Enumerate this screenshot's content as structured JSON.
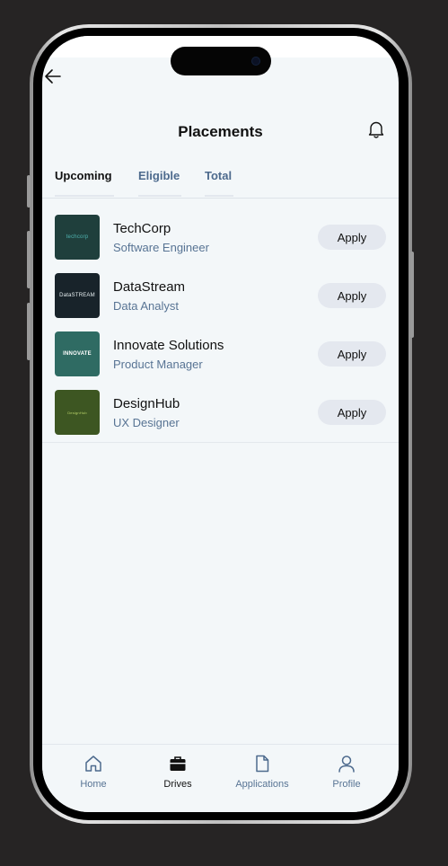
{
  "header": {
    "title": "Placements"
  },
  "tabs": [
    {
      "label": "Upcoming",
      "active": true
    },
    {
      "label": "Eligible",
      "active": false
    },
    {
      "label": "Total",
      "active": false
    }
  ],
  "placements": [
    {
      "company": "TechCorp",
      "role": "Software Engineer",
      "apply_label": "Apply",
      "logo_text": "techcorp",
      "logo_bg": "#1f3f3c"
    },
    {
      "company": "DataStream",
      "role": "Data Analyst",
      "apply_label": "Apply",
      "logo_text": "DataSTREAM",
      "logo_bg": "#18232a"
    },
    {
      "company": "Innovate Solutions",
      "role": "Product Manager",
      "apply_label": "Apply",
      "logo_text": "INNOVATE",
      "logo_bg": "#2f6b63"
    },
    {
      "company": "DesignHub",
      "role": "UX Designer",
      "apply_label": "Apply",
      "logo_text": "DesignHub",
      "logo_bg": "#3d5622"
    }
  ],
  "bottom_nav": [
    {
      "label": "Home",
      "icon": "home-icon",
      "active": false
    },
    {
      "label": "Drives",
      "icon": "briefcase-icon",
      "active": true
    },
    {
      "label": "Applications",
      "icon": "document-icon",
      "active": false
    },
    {
      "label": "Profile",
      "icon": "user-icon",
      "active": false
    }
  ],
  "colors": {
    "screen_bg": "#f3f7f9",
    "muted_text": "#587494",
    "button_bg": "#e4e8ef",
    "body_bg": "#262424"
  }
}
